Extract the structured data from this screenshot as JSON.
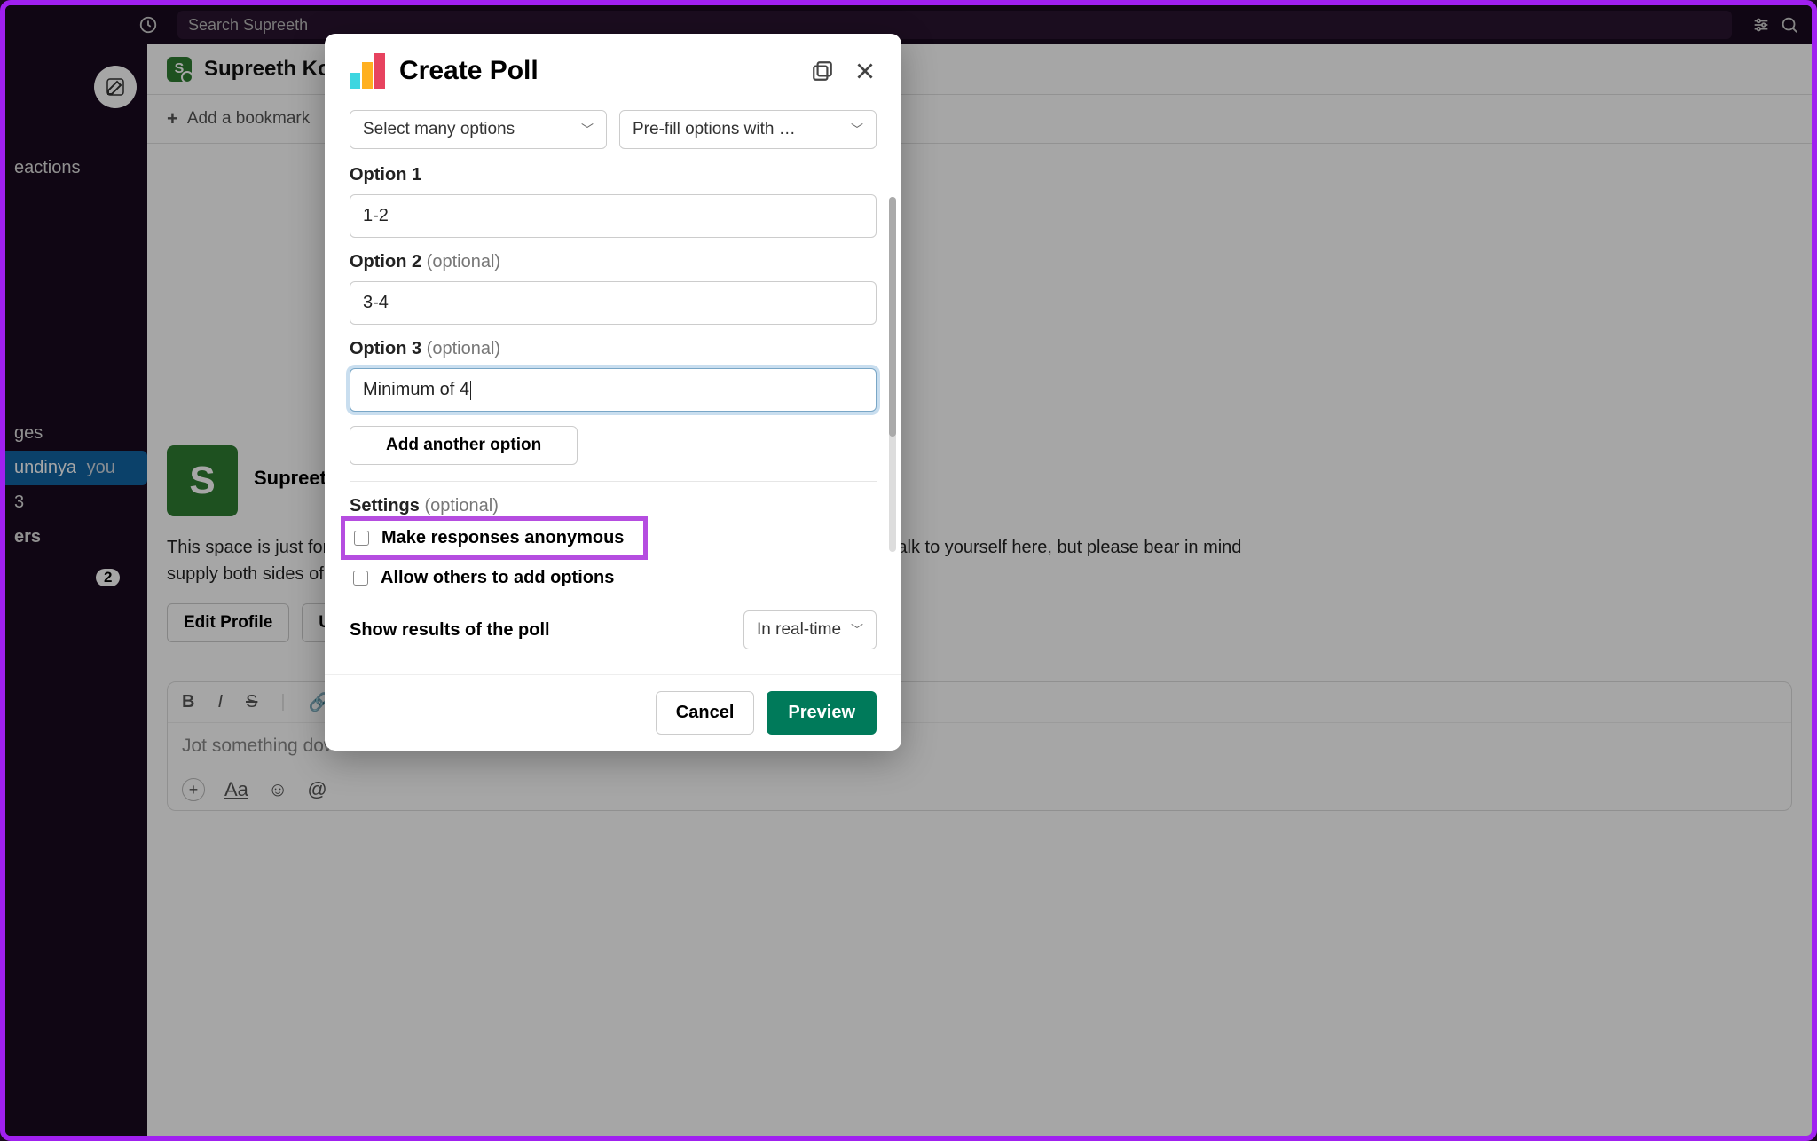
{
  "topbar": {
    "search_placeholder": "Search Supreeth"
  },
  "sidebar": {
    "items": [
      "eactions",
      "ges",
      "undinya",
      "3",
      "ers"
    ],
    "you_label": "you",
    "badge": "2"
  },
  "header": {
    "workspace_name": "Supreeth Kou",
    "avatar_initial": "S",
    "bookmark_label": "Add a bookmark"
  },
  "profile": {
    "avatar_initial": "S",
    "name": "Supreeth K",
    "space_text_1": "This space is just for",
    "space_text_2": "talk to yourself here, but please bear in mind",
    "space_text_3": "supply both sides of t",
    "edit_profile": "Edit Profile",
    "up_button": "Up"
  },
  "composer": {
    "placeholder": "Jot something dow"
  },
  "modal": {
    "title": "Create Poll",
    "select_many": "Select many options",
    "prefill": "Pre-fill options with …",
    "option1_label": "Option 1",
    "option1_value": "1-2",
    "option2_label": "Option 2",
    "option2_value": "3-4",
    "option3_label": "Option 3",
    "option3_value": "Minimum of 4",
    "optional_label": "(optional)",
    "add_option": "Add another option",
    "settings_label": "Settings",
    "anon_label": "Make responses anonymous",
    "allow_add_label": "Allow others to add options",
    "show_results_label": "Show results of the poll",
    "show_results_value": "In real-time",
    "cancel": "Cancel",
    "preview": "Preview"
  }
}
